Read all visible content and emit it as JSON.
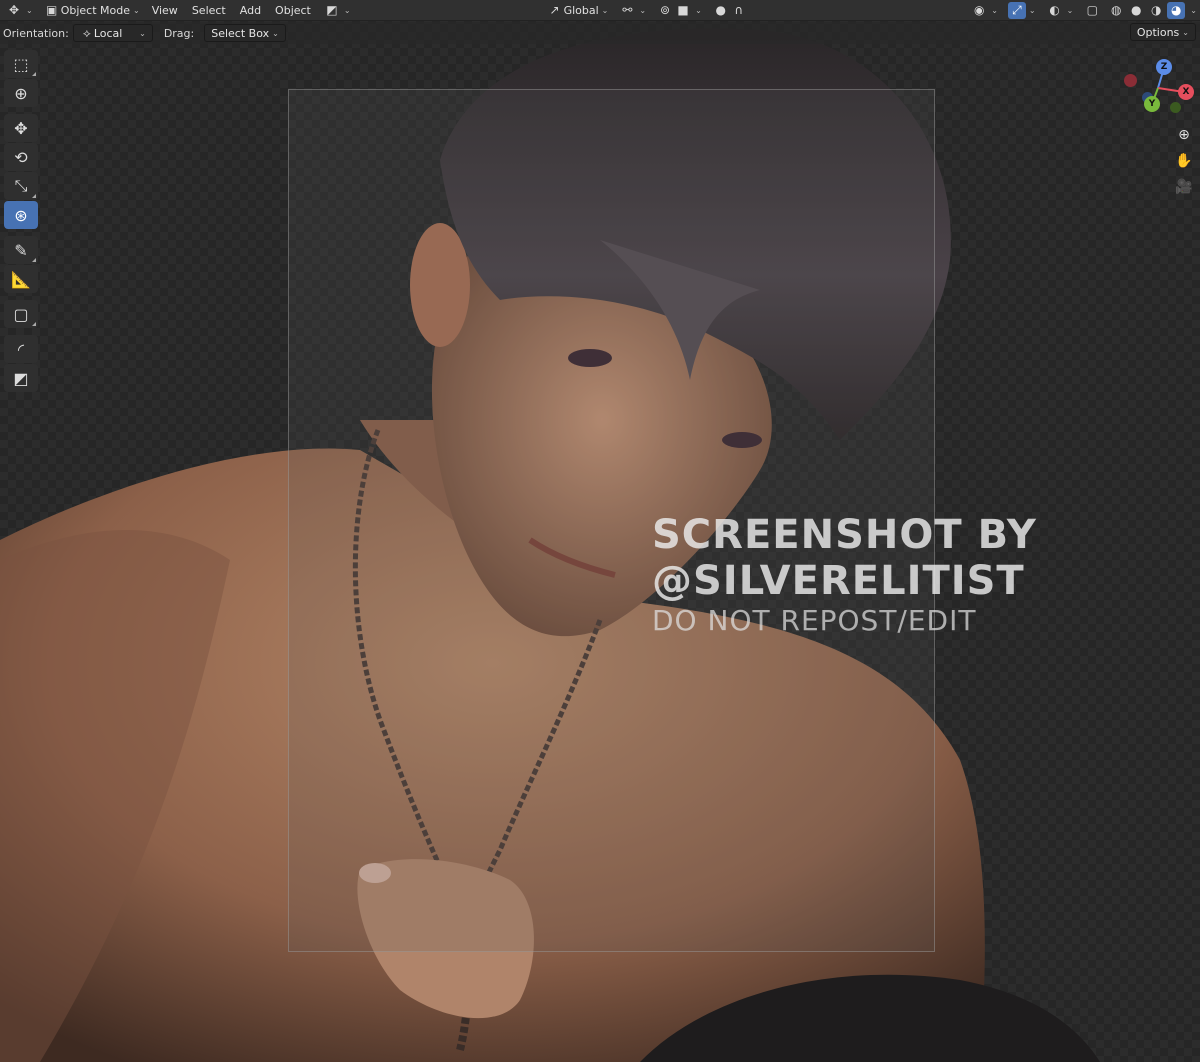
{
  "header": {
    "editor_type_icon": "3d-viewport-icon",
    "mode": "Object Mode",
    "menus": [
      "View",
      "Select",
      "Add",
      "Object"
    ],
    "transform_orientation": "Global",
    "right_icons": [
      "visibility-icon",
      "gizmo-icon",
      "overlay-icon",
      "xray-icon",
      "wireframe-shading-icon",
      "solid-shading-icon",
      "material-shading-icon",
      "rendered-shading-icon"
    ]
  },
  "tool_settings": {
    "orientation_label": "Orientation:",
    "orientation_value": "Local",
    "drag_label": "Drag:",
    "drag_value": "Select Box",
    "options_label": "Options"
  },
  "toolbar": {
    "tools": [
      "select-box",
      "cursor",
      "move",
      "rotate",
      "scale",
      "transform",
      "annotate",
      "measure",
      "add-cube",
      "bevel",
      "shear"
    ],
    "active_tool": "transform"
  },
  "gizmo": {
    "axes": [
      "Z",
      "X",
      "Y"
    ]
  },
  "watermark": {
    "line1": "SCREENSHOT BY",
    "line2": "@SILVERELITIST",
    "line3": "DO NOT REPOST/EDIT"
  },
  "colors": {
    "accent": "#4772b3",
    "axis_x": "#e64e5d",
    "axis_y": "#79b93c",
    "axis_z": "#5b8ce8"
  }
}
